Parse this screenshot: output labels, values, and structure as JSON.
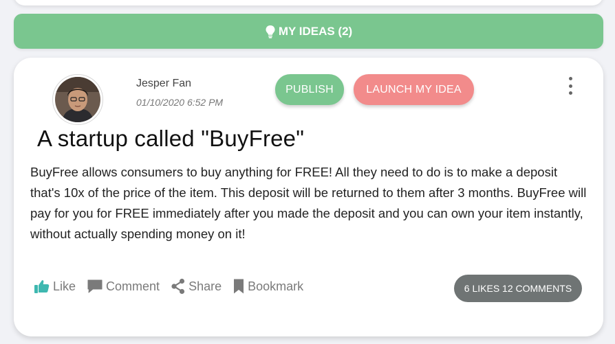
{
  "ideas_header": {
    "label": "MY IDEAS (2)",
    "icon": "lightbulb-icon"
  },
  "post": {
    "author": "Jesper Fan",
    "date": "01/10/2020 6:52 PM",
    "publish_label": "PUBLISH",
    "launch_label": "LAUNCH MY IDEA",
    "title": "A startup called \"BuyFree\"",
    "body": "BuyFree allows consumers to buy anything for FREE! All they need to do is to make a deposit that's 10x of the price of the item. This deposit will be returned to them after 3 months. BuyFree will pay for you for FREE immediately after you made the deposit and you can own your item instantly, without actually spending money on it!",
    "actions": {
      "like": "Like",
      "comment": "Comment",
      "share": "Share",
      "bookmark": "Bookmark"
    },
    "stats": "6 LIKES 12 COMMENTS"
  },
  "colors": {
    "accent_green": "#7ac68f",
    "accent_red": "#f28b8b",
    "like_teal": "#3eb8b0",
    "stats_gray": "#6f7474"
  }
}
